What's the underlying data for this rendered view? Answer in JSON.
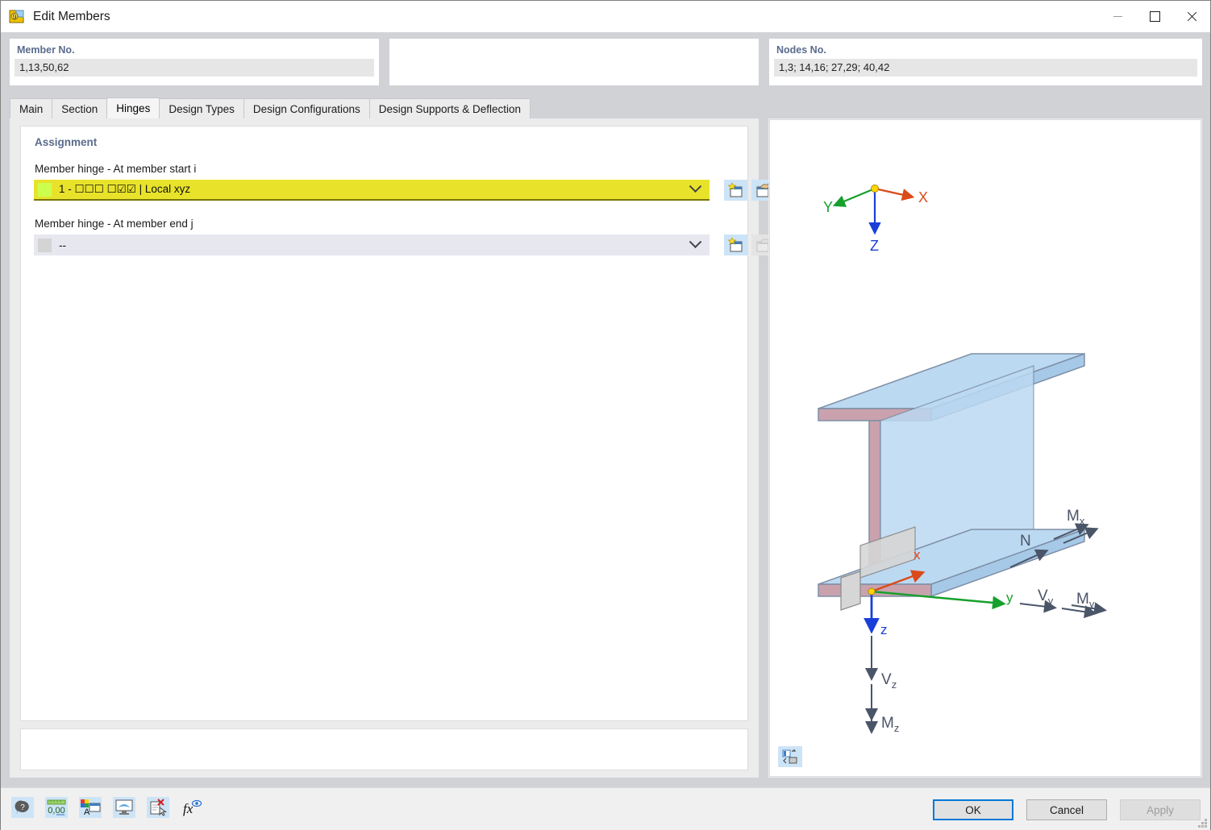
{
  "window": {
    "title": "Edit Members",
    "app_icon": "rfem-app-icon",
    "controls": {
      "minimize": "minimize-icon",
      "maximize": "maximize-icon",
      "close": "close-icon"
    }
  },
  "header": {
    "member": {
      "label": "Member No.",
      "value": "1,13,50,62"
    },
    "middle": {
      "label": "",
      "value": ""
    },
    "nodes": {
      "label": "Nodes No.",
      "value": "1,3; 14,16; 27,29; 40,42"
    }
  },
  "tabs": [
    {
      "label": "Main",
      "active": false
    },
    {
      "label": "Section",
      "active": false
    },
    {
      "label": "Hinges",
      "active": true
    },
    {
      "label": "Design Types",
      "active": false
    },
    {
      "label": "Design Configurations",
      "active": false
    },
    {
      "label": "Design Supports & Deflection",
      "active": false
    }
  ],
  "assignment": {
    "title": "Assignment",
    "start": {
      "label": "Member hinge - At member start i",
      "value": "1 - ☐☐☐  ☐☑☑ | Local xyz",
      "swatch_color": "#ccff4d",
      "highlight_color": "#e8e32a",
      "new_button": "new-hinge-icon",
      "edit_button": "edit-hinge-icon",
      "edit_enabled": true
    },
    "end": {
      "label": "Member hinge - At member end j",
      "value": "--",
      "swatch_color": "#d4d4d4",
      "new_button": "new-hinge-icon",
      "edit_button": "edit-hinge-icon",
      "edit_enabled": false
    },
    "notes": ""
  },
  "graphic": {
    "global_axes": {
      "x": {
        "label": "X",
        "color": "#d94b1a"
      },
      "y": {
        "label": "Y",
        "color": "#17a02c"
      },
      "z": {
        "label": "Z",
        "color": "#1a3fd9"
      },
      "origin": "origin-node"
    },
    "local_axes": {
      "x": {
        "label": "x",
        "color": "#d94b1a"
      },
      "y": {
        "label": "y",
        "color": "#17a02c"
      },
      "z": {
        "label": "z",
        "color": "#1a3fd9"
      }
    },
    "internal_forces": [
      {
        "label": "N",
        "sub": "",
        "name": "axial-force-arrow"
      },
      {
        "label": "M",
        "sub": "x",
        "name": "torsional-moment-arrow"
      },
      {
        "label": "V",
        "sub": "y",
        "name": "shear-force-y-arrow"
      },
      {
        "label": "M",
        "sub": "y",
        "name": "bending-moment-y-arrow"
      },
      {
        "label": "V",
        "sub": "z",
        "name": "shear-force-z-arrow"
      },
      {
        "label": "M",
        "sub": "z",
        "name": "bending-moment-z-arrow"
      }
    ],
    "section_colors": {
      "flange_face": "#c9a2ae",
      "web_face": "#bcd9f2",
      "edge": "#7e8fa6"
    },
    "render_button": "render-mode-icon"
  },
  "toolbar": [
    {
      "name": "help-icon",
      "label": ""
    },
    {
      "name": "number-format-icon",
      "label": "0,00"
    },
    {
      "name": "display-properties-icon",
      "label": ""
    },
    {
      "name": "view-settings-icon",
      "label": ""
    },
    {
      "name": "clear-selection-icon",
      "label": ""
    },
    {
      "name": "formula-icon",
      "label": "fx"
    }
  ],
  "actions": {
    "ok": "OK",
    "cancel": "Cancel",
    "apply": "Apply",
    "apply_enabled": false
  }
}
